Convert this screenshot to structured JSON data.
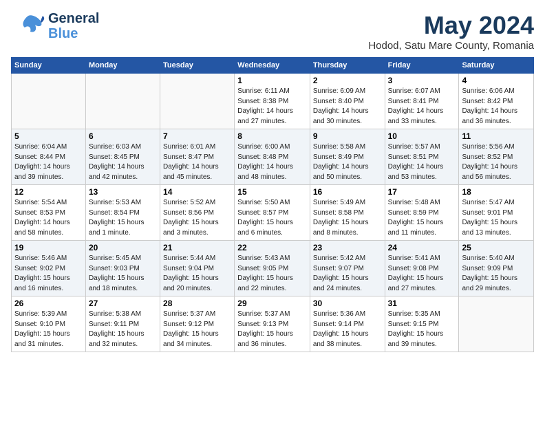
{
  "header": {
    "logo_general": "General",
    "logo_blue": "Blue",
    "month_year": "May 2024",
    "location": "Hodod, Satu Mare County, Romania"
  },
  "weekdays": [
    "Sunday",
    "Monday",
    "Tuesday",
    "Wednesday",
    "Thursday",
    "Friday",
    "Saturday"
  ],
  "weeks": [
    [
      {
        "day": "",
        "info": ""
      },
      {
        "day": "",
        "info": ""
      },
      {
        "day": "",
        "info": ""
      },
      {
        "day": "1",
        "info": "Sunrise: 6:11 AM\nSunset: 8:38 PM\nDaylight: 14 hours\nand 27 minutes."
      },
      {
        "day": "2",
        "info": "Sunrise: 6:09 AM\nSunset: 8:40 PM\nDaylight: 14 hours\nand 30 minutes."
      },
      {
        "day": "3",
        "info": "Sunrise: 6:07 AM\nSunset: 8:41 PM\nDaylight: 14 hours\nand 33 minutes."
      },
      {
        "day": "4",
        "info": "Sunrise: 6:06 AM\nSunset: 8:42 PM\nDaylight: 14 hours\nand 36 minutes."
      }
    ],
    [
      {
        "day": "5",
        "info": "Sunrise: 6:04 AM\nSunset: 8:44 PM\nDaylight: 14 hours\nand 39 minutes."
      },
      {
        "day": "6",
        "info": "Sunrise: 6:03 AM\nSunset: 8:45 PM\nDaylight: 14 hours\nand 42 minutes."
      },
      {
        "day": "7",
        "info": "Sunrise: 6:01 AM\nSunset: 8:47 PM\nDaylight: 14 hours\nand 45 minutes."
      },
      {
        "day": "8",
        "info": "Sunrise: 6:00 AM\nSunset: 8:48 PM\nDaylight: 14 hours\nand 48 minutes."
      },
      {
        "day": "9",
        "info": "Sunrise: 5:58 AM\nSunset: 8:49 PM\nDaylight: 14 hours\nand 50 minutes."
      },
      {
        "day": "10",
        "info": "Sunrise: 5:57 AM\nSunset: 8:51 PM\nDaylight: 14 hours\nand 53 minutes."
      },
      {
        "day": "11",
        "info": "Sunrise: 5:56 AM\nSunset: 8:52 PM\nDaylight: 14 hours\nand 56 minutes."
      }
    ],
    [
      {
        "day": "12",
        "info": "Sunrise: 5:54 AM\nSunset: 8:53 PM\nDaylight: 14 hours\nand 58 minutes."
      },
      {
        "day": "13",
        "info": "Sunrise: 5:53 AM\nSunset: 8:54 PM\nDaylight: 15 hours\nand 1 minute."
      },
      {
        "day": "14",
        "info": "Sunrise: 5:52 AM\nSunset: 8:56 PM\nDaylight: 15 hours\nand 3 minutes."
      },
      {
        "day": "15",
        "info": "Sunrise: 5:50 AM\nSunset: 8:57 PM\nDaylight: 15 hours\nand 6 minutes."
      },
      {
        "day": "16",
        "info": "Sunrise: 5:49 AM\nSunset: 8:58 PM\nDaylight: 15 hours\nand 8 minutes."
      },
      {
        "day": "17",
        "info": "Sunrise: 5:48 AM\nSunset: 8:59 PM\nDaylight: 15 hours\nand 11 minutes."
      },
      {
        "day": "18",
        "info": "Sunrise: 5:47 AM\nSunset: 9:01 PM\nDaylight: 15 hours\nand 13 minutes."
      }
    ],
    [
      {
        "day": "19",
        "info": "Sunrise: 5:46 AM\nSunset: 9:02 PM\nDaylight: 15 hours\nand 16 minutes."
      },
      {
        "day": "20",
        "info": "Sunrise: 5:45 AM\nSunset: 9:03 PM\nDaylight: 15 hours\nand 18 minutes."
      },
      {
        "day": "21",
        "info": "Sunrise: 5:44 AM\nSunset: 9:04 PM\nDaylight: 15 hours\nand 20 minutes."
      },
      {
        "day": "22",
        "info": "Sunrise: 5:43 AM\nSunset: 9:05 PM\nDaylight: 15 hours\nand 22 minutes."
      },
      {
        "day": "23",
        "info": "Sunrise: 5:42 AM\nSunset: 9:07 PM\nDaylight: 15 hours\nand 24 minutes."
      },
      {
        "day": "24",
        "info": "Sunrise: 5:41 AM\nSunset: 9:08 PM\nDaylight: 15 hours\nand 27 minutes."
      },
      {
        "day": "25",
        "info": "Sunrise: 5:40 AM\nSunset: 9:09 PM\nDaylight: 15 hours\nand 29 minutes."
      }
    ],
    [
      {
        "day": "26",
        "info": "Sunrise: 5:39 AM\nSunset: 9:10 PM\nDaylight: 15 hours\nand 31 minutes."
      },
      {
        "day": "27",
        "info": "Sunrise: 5:38 AM\nSunset: 9:11 PM\nDaylight: 15 hours\nand 32 minutes."
      },
      {
        "day": "28",
        "info": "Sunrise: 5:37 AM\nSunset: 9:12 PM\nDaylight: 15 hours\nand 34 minutes."
      },
      {
        "day": "29",
        "info": "Sunrise: 5:37 AM\nSunset: 9:13 PM\nDaylight: 15 hours\nand 36 minutes."
      },
      {
        "day": "30",
        "info": "Sunrise: 5:36 AM\nSunset: 9:14 PM\nDaylight: 15 hours\nand 38 minutes."
      },
      {
        "day": "31",
        "info": "Sunrise: 5:35 AM\nSunset: 9:15 PM\nDaylight: 15 hours\nand 39 minutes."
      },
      {
        "day": "",
        "info": ""
      }
    ]
  ]
}
